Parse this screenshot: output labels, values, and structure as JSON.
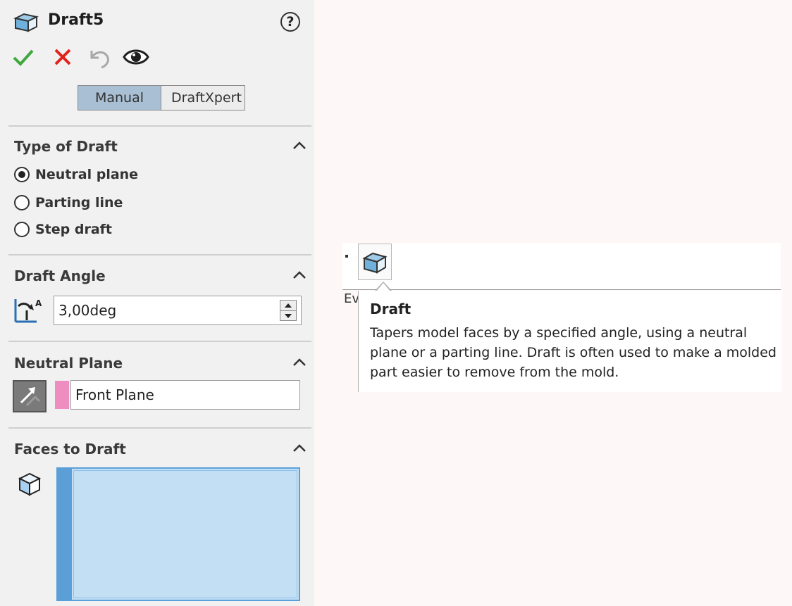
{
  "header": {
    "title": "Draft5",
    "help_glyph": "?"
  },
  "actions": [
    "ok-icon",
    "cancel-icon",
    "undo-icon",
    "preview-eye-icon"
  ],
  "mode_tabs": [
    {
      "label": "Manual",
      "active": true
    },
    {
      "label": "DraftXpert",
      "active": false
    }
  ],
  "sections": {
    "type_of_draft": {
      "title": "Type of Draft",
      "options": [
        {
          "label": "Neutral plane",
          "selected": true
        },
        {
          "label": "Parting line",
          "selected": false
        },
        {
          "label": "Step draft",
          "selected": false
        }
      ]
    },
    "draft_angle": {
      "title": "Draft Angle",
      "value": "3,00deg"
    },
    "neutral_plane": {
      "title": "Neutral Plane",
      "value": "Front Plane",
      "swatch_color": "#ee8ec0"
    },
    "faces_to_draft": {
      "title": "Faces to Draft"
    }
  },
  "toolbar": {
    "tab_fragment": "Ev"
  },
  "tooltip": {
    "title": "Draft",
    "body": "Tapers model faces by a specified angle, using a neutral plane or a parting line. Draft is often used to make a molded part easier to remove from the mold."
  },
  "colors": {
    "accent_selection": "#5c9ed6",
    "ok_green": "#3ea83e",
    "cancel_red": "#e0221c",
    "active_tab": "#a9bfd3"
  }
}
